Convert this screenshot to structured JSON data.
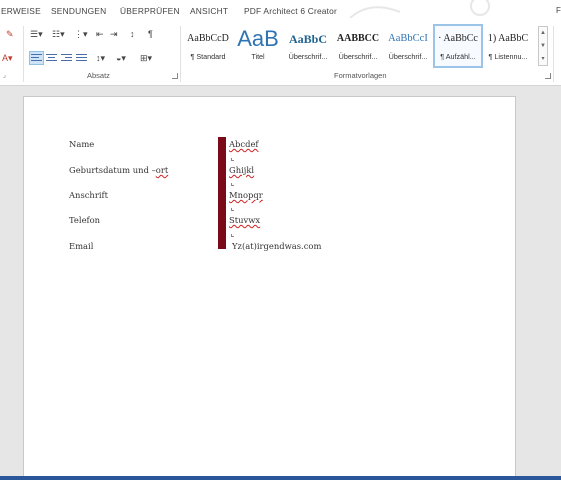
{
  "tabs": [
    "ERWEISE",
    "SENDUNGEN",
    "ÜBERPRÜFEN",
    "ANSICHT",
    "PDF Architect 6 Creator"
  ],
  "tab_edge": "F",
  "ribbon": {
    "group_absatz": "Absatz",
    "group_formatvorlagen": "Formatvorlagen",
    "styles": [
      {
        "sample": "AaBbCcD",
        "name": "¶ Standard"
      },
      {
        "sample": "AaB",
        "name": "Titel"
      },
      {
        "sample": "AaBbC",
        "name": "Überschrif..."
      },
      {
        "sample": "AABBCC",
        "name": "Überschrif..."
      },
      {
        "sample": "AaBbCcI",
        "name": "Überschrif..."
      },
      {
        "sample": "· AaBbCc",
        "name": "¶ Aufzähl..."
      },
      {
        "sample": "1) AaBbC",
        "name": "¶ Listennu..."
      }
    ]
  },
  "document": {
    "rows": [
      {
        "label": "Name",
        "value": "Abcdef"
      },
      {
        "label": "Geburtsdatum und –",
        "label_spell": "ort",
        "value": "Ghijkl"
      },
      {
        "label": "Anschrift",
        "value": "Mnopqr"
      },
      {
        "label": "Telefon",
        "value": "Stuvwx"
      },
      {
        "label": "Email",
        "value": "Yz(at)irgendwas.com"
      }
    ]
  },
  "colors": {
    "accent_bar": "#7a0a18",
    "statusbar": "#2b579a",
    "selected_style": "#9cc4e8"
  }
}
